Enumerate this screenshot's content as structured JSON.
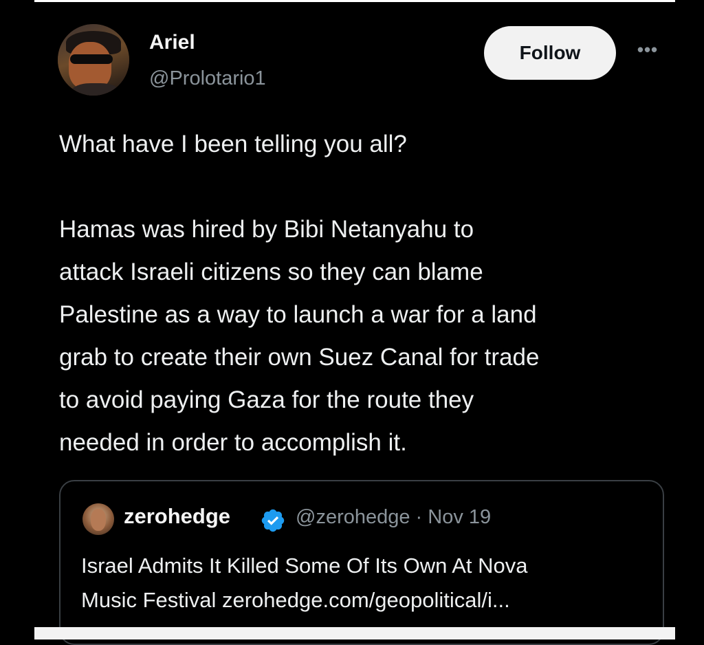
{
  "tweet": {
    "author": {
      "display_name": "Ariel",
      "handle": "@Prolotario1"
    },
    "follow_label": "Follow",
    "more_label": "•••",
    "text_lines": [
      "What have I been telling you all?",
      "Hamas was hired by Bibi Netanyahu to",
      "attack Israeli citizens so they can blame",
      "Palestine as a way to launch a war for a land",
      "grab to create their own Suez Canal for trade",
      "to avoid paying Gaza for the route they",
      "needed in order to accomplish it."
    ]
  },
  "quoted_tweet": {
    "display_name": "zerohedge",
    "verified": true,
    "meta": "@zerohedge · Nov 19",
    "text_lines": [
      "Israel Admits It Killed Some Of Its Own At Nova",
      "Music Festival zerohedge.com/geopolitical/i..."
    ]
  },
  "colors": {
    "background": "#000000",
    "text_primary": "#eef0f1",
    "text_secondary": "#8b949b",
    "follow_bg": "#f2f2f2",
    "verified_blue": "#1d9bf0",
    "quote_border": "#3a3f44"
  }
}
